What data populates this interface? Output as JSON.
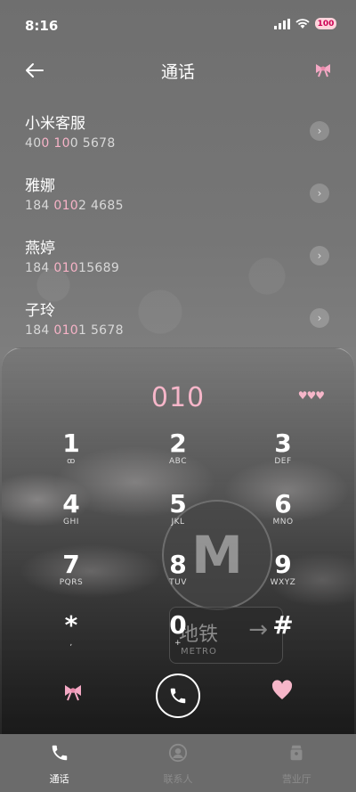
{
  "status_bar": {
    "time": "8:16",
    "battery": "100"
  },
  "header": {
    "title": "通话",
    "back_icon": "arrow-left-icon",
    "bow_icon": "bow-icon"
  },
  "contacts": [
    {
      "name": "小米客服",
      "number_parts": [
        "40",
        "0 10",
        "0 5678"
      ]
    },
    {
      "name": "雅娜",
      "number_parts": [
        "184 ",
        "010",
        "2 4685"
      ]
    },
    {
      "name": "燕婷",
      "number_parts": [
        "184 ",
        "010",
        "15689"
      ]
    },
    {
      "name": "子玲",
      "number_parts": [
        "184 ",
        "010",
        "1 5678"
      ]
    }
  ],
  "dialpad": {
    "display": "010",
    "hearts": "♥♥♥",
    "keys": [
      {
        "digit": "1",
        "letters": "ꝏ"
      },
      {
        "digit": "2",
        "letters": "ABC"
      },
      {
        "digit": "3",
        "letters": "DEF"
      },
      {
        "digit": "4",
        "letters": "GHI"
      },
      {
        "digit": "5",
        "letters": "JKL"
      },
      {
        "digit": "6",
        "letters": "MNO"
      },
      {
        "digit": "7",
        "letters": "PQRS"
      },
      {
        "digit": "8",
        "letters": "TUV"
      },
      {
        "digit": "9",
        "letters": "WXYZ"
      },
      {
        "digit": "*",
        "letters": ","
      },
      {
        "digit": "0",
        "letters": "+"
      },
      {
        "digit": "#",
        "letters": ""
      }
    ],
    "background": {
      "sign_letter": "M",
      "board_cn": "地铁",
      "board_en": "METRO"
    }
  },
  "bottom_nav": [
    {
      "label": "通话",
      "icon": "phone-icon",
      "active": true
    },
    {
      "label": "联系人",
      "icon": "contacts-icon",
      "active": false
    },
    {
      "label": "营业厅",
      "icon": "store-icon",
      "active": false
    }
  ],
  "colors": {
    "accent_pink": "#f6b6c9",
    "nav_bg": "#6b6b6b"
  }
}
